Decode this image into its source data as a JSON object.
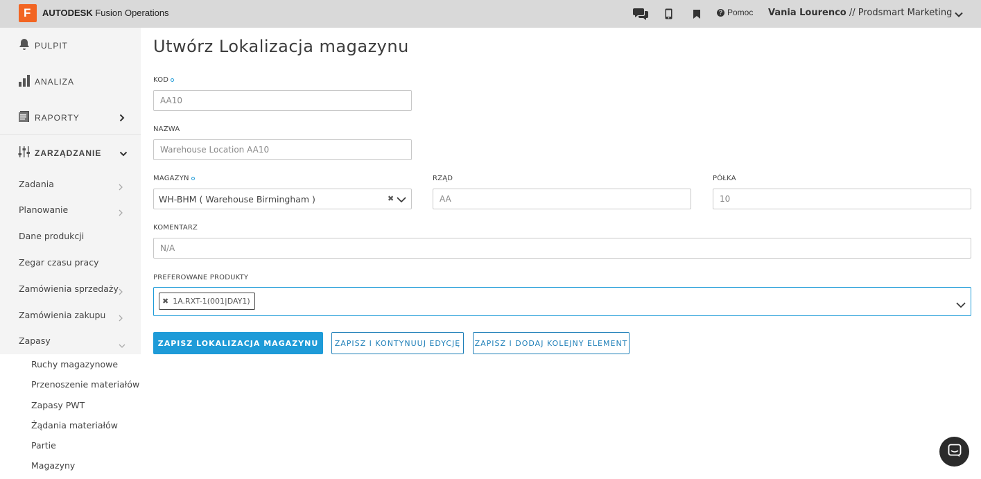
{
  "app": {
    "logo_letter": "F",
    "brand_bold": "AUTODESK",
    "brand_rest": " Fusion Operations"
  },
  "topbar": {
    "icons": [
      "chat-icon",
      "mobile-icon",
      "bookmark-icon",
      "help-icon"
    ],
    "help_label": "Pomoc",
    "user_name": "Vania Lourenco",
    "org_name": " // Prodsmart Marketing"
  },
  "sidebar": {
    "main": [
      {
        "label": "PULPIT",
        "icon": "bell-icon"
      },
      {
        "label": "ANALIZA",
        "icon": "bar-chart-icon"
      },
      {
        "label": "RAPORTY",
        "icon": "report-icon"
      },
      {
        "label": "ZARZĄDZANIE",
        "icon": "sliders-icon"
      }
    ],
    "items": [
      {
        "label": "Zadania"
      },
      {
        "label": "Planowanie"
      },
      {
        "label": "Dane produkcji"
      },
      {
        "label": "Zegar czasu pracy"
      },
      {
        "label": "Zamówienia sprzedaży"
      },
      {
        "label": "Zamówienia zakupu"
      },
      {
        "label": "Zapasy"
      }
    ],
    "subitems": [
      {
        "label": "Ruchy magazynowe"
      },
      {
        "label": "Przenoszenie materiałów"
      },
      {
        "label": "Zapasy PWT"
      },
      {
        "label": "Żądania materiałów"
      },
      {
        "label": "Partie"
      },
      {
        "label": "Magazyny"
      }
    ]
  },
  "page": {
    "title": "Utwórz Lokalizacja magazynu"
  },
  "form": {
    "kod": {
      "label": "KOD",
      "value": "AA10"
    },
    "nazwa": {
      "label": "NAZWA",
      "value": "Warehouse Location AA10"
    },
    "magazyn": {
      "label": "MAGAZYN",
      "value": "WH-BHM ( Warehouse Birmingham )"
    },
    "rzad": {
      "label": "RZĄD",
      "value": "AA"
    },
    "polka": {
      "label": "PÓŁKA",
      "value": "10"
    },
    "komentarz": {
      "label": "KOMENTARZ",
      "value": "N/A"
    },
    "preferowane": {
      "label": "PREFEROWANE PRODUKTY",
      "tags": [
        "1A.RXT-1(001|DAY1)"
      ]
    }
  },
  "actions": {
    "save": "ZAPISZ LOKALIZACJA MAGAZYNU",
    "save_continue": "ZAPISZ I KONTYNUUJ EDYCJĘ",
    "save_add": "ZAPISZ I DODAJ KOLEJNY ELEMENT"
  },
  "colors": {
    "accent": "#1e9bd8",
    "logo": "#f26522",
    "topbar": "#d9d9d9",
    "sidebar": "#f4f4f4"
  }
}
